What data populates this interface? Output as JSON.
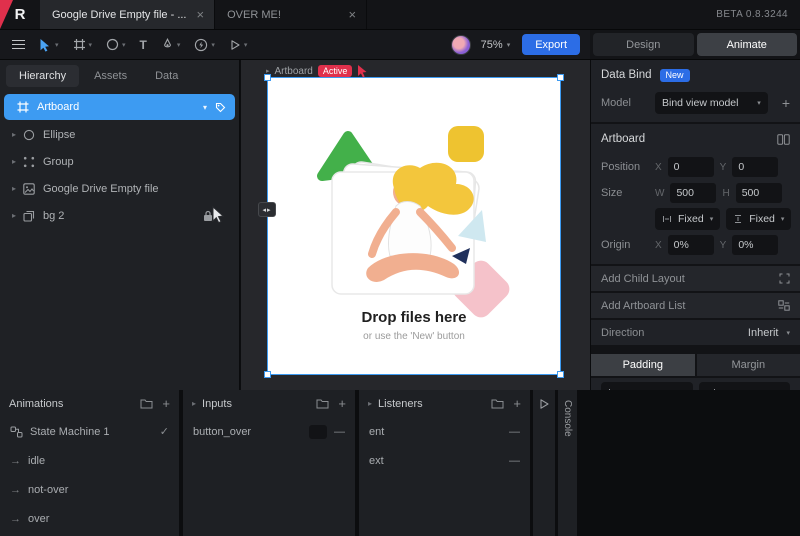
{
  "topbar": {
    "beta": "BETA 0.8.3244",
    "tabs": [
      {
        "label": "Google Drive Empty file - ...",
        "active": true
      },
      {
        "label": "OVER ME!",
        "active": false
      }
    ]
  },
  "toolbar": {
    "zoom": "75%",
    "export": "Export",
    "design": "Design",
    "animate": "Animate"
  },
  "hierarchy": {
    "tabs": {
      "hierarchy": "Hierarchy",
      "assets": "Assets",
      "data": "Data"
    },
    "items": [
      {
        "label": "Artboard",
        "selected": true
      },
      {
        "label": "Ellipse"
      },
      {
        "label": "Group"
      },
      {
        "label": "Google Drive Empty file"
      },
      {
        "label": "bg 2",
        "locked": true
      }
    ]
  },
  "canvas": {
    "artboard_name": "Artboard",
    "active_badge": "Active",
    "drop_title": "Drop files here",
    "drop_subtitle": "or use the 'New' button"
  },
  "inspector": {
    "data_bind": {
      "title": "Data Bind",
      "badge": "New",
      "model_label": "Model",
      "model_value": "Bind view model"
    },
    "artboard": {
      "title": "Artboard",
      "position": {
        "label": "Position",
        "x_label": "X",
        "x": "0",
        "y_label": "Y",
        "y": "0"
      },
      "size": {
        "label": "Size",
        "w_label": "W",
        "w": "500",
        "h_label": "H",
        "h": "500"
      },
      "fit": {
        "width": "Fixed",
        "height": "Fixed"
      },
      "origin": {
        "label": "Origin",
        "x_label": "X",
        "x": "0%",
        "y_label": "Y",
        "y": "0%"
      }
    },
    "layout": {
      "add_child_layout": "Add Child Layout",
      "add_artboard_list": "Add Artboard List",
      "direction_label": "Direction",
      "direction_value": "Inherit",
      "padding": "Padding",
      "margin": "Margin"
    }
  },
  "timeline": {
    "animations": {
      "title": "Animations",
      "items": [
        {
          "label": "State Machine 1",
          "type": "state-machine"
        },
        {
          "label": "idle",
          "type": "animation"
        },
        {
          "label": "not-over",
          "type": "animation"
        },
        {
          "label": "over",
          "type": "animation"
        }
      ]
    },
    "inputs": {
      "title": "Inputs",
      "items": [
        {
          "label": "button_over"
        }
      ]
    },
    "listeners": {
      "title": "Listeners",
      "items": [
        {
          "label": "ent"
        },
        {
          "label": "ext"
        }
      ]
    },
    "console": "Console"
  },
  "icons": {
    "close": "×",
    "plus": "+",
    "dash": "—",
    "check": "✓",
    "chevron_down": "▾",
    "chevron_right": "▸",
    "arrow_right": "→",
    "resize": "◂▸",
    "text_tool": "T"
  },
  "colors": {
    "accent_blue": "#3d9bf2",
    "export_blue": "#2c6de6",
    "badge_red": "#e0304c",
    "green": "#43b04a",
    "yellow": "#eec330",
    "pink": "#f5c2ca"
  }
}
